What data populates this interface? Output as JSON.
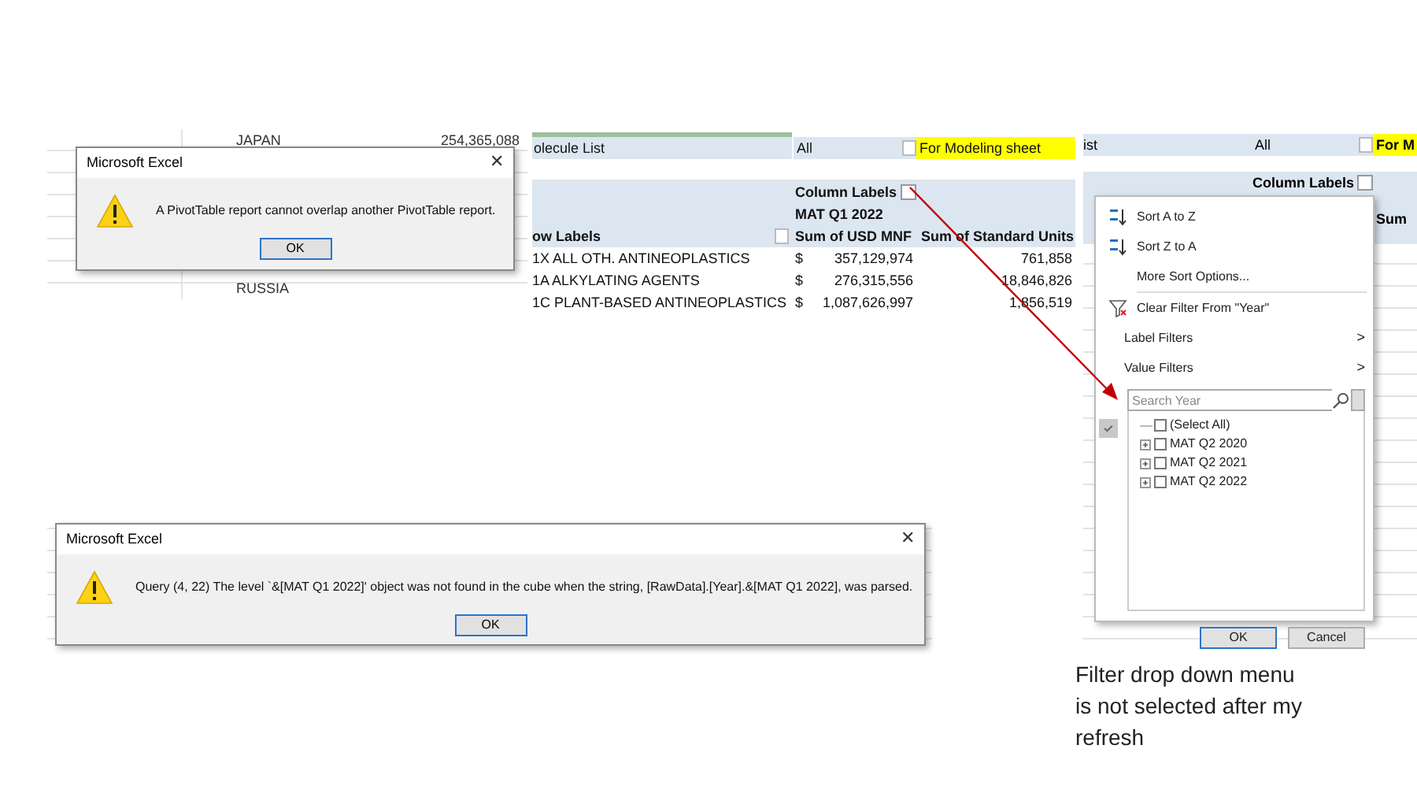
{
  "sheet_top": {
    "cells": [
      {
        "text": "JAPAN",
        "kind": "name"
      },
      {
        "text": "254,365,088",
        "kind": "number"
      },
      {
        "text": "RUSSIA",
        "kind": "name"
      }
    ]
  },
  "dialogs": [
    {
      "title": "Microsoft Excel",
      "close": "✕",
      "message": "A PivotTable report cannot overlap another PivotTable report.",
      "button": "OK"
    },
    {
      "title": "Microsoft Excel",
      "close": "✕",
      "message": "Query (4, 22) The level `&[MAT Q1 2022]' object was not found in the cube when the string, [RawData].[Year].&[MAT Q1 2022], was parsed.",
      "button": "OK"
    }
  ],
  "pivot": {
    "filter_label": "olecule List",
    "filter_value": "All",
    "note": "For Modeling sheet",
    "column_labels": "Column Labels",
    "column_value": "MAT Q1 2022",
    "headers": [
      "ow Labels",
      "Sum of USD MNF",
      "Sum of Standard Units"
    ],
    "rows": [
      {
        "label": "1X ALL OTH. ANTINEOPLASTICS",
        "currency": "$",
        "usd": "357,129,974",
        "units": "761,858"
      },
      {
        "label": "1A ALKYLATING AGENTS",
        "currency": "$",
        "usd": "276,315,556",
        "units": "18,846,826"
      },
      {
        "label": "1C PLANT-BASED ANTINEOPLASTICS",
        "currency": "$",
        "usd": "1,087,626,997",
        "units": "1,856,519"
      }
    ]
  },
  "filter_panel": {
    "filter_label": "ist",
    "filter_value": "All",
    "note": "For M",
    "column_labels": "Column Labels",
    "header": "Sum",
    "menu": {
      "items": [
        {
          "kind": "sort_asc",
          "label": "Sort A to Z"
        },
        {
          "kind": "sort_desc",
          "label": "Sort Z to A"
        },
        {
          "kind": "plain",
          "label": "More Sort Options..."
        },
        {
          "kind": "clear",
          "label": "Clear Filter From \"Year\""
        },
        {
          "kind": "submenu",
          "label": "Label Filters",
          "arrow": ">"
        },
        {
          "kind": "submenu",
          "label": "Value Filters",
          "arrow": ">"
        }
      ],
      "search": {
        "placeholder": "Search Year"
      },
      "tree": [
        {
          "label": "(Select All)",
          "checked": false,
          "expandable": false
        },
        {
          "label": "MAT Q2 2020",
          "checked": false,
          "expandable": true
        },
        {
          "label": "MAT Q2 2021",
          "checked": false,
          "expandable": true
        },
        {
          "label": "MAT Q2 2022",
          "checked": false,
          "expandable": true
        }
      ],
      "side_check": {
        "checked": true
      },
      "buttons": [
        {
          "label": "OK",
          "default": true
        },
        {
          "label": "Cancel",
          "default": false
        }
      ]
    }
  },
  "annotation": {
    "text": "Filter drop down menu is not selected after my refresh"
  }
}
